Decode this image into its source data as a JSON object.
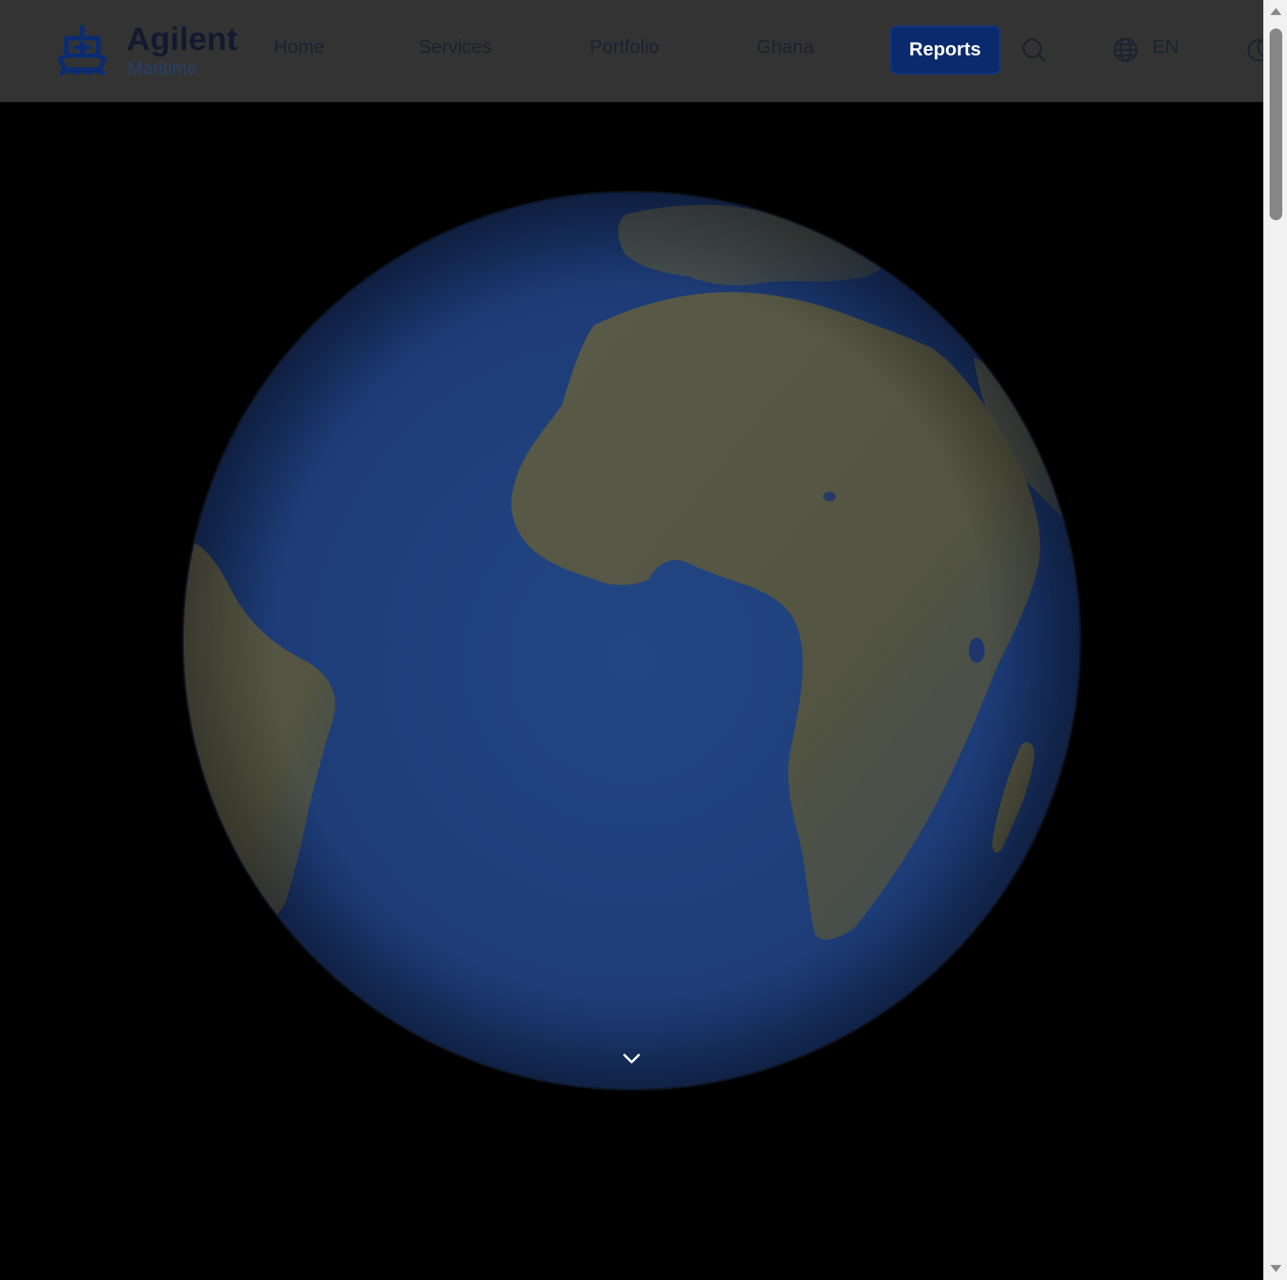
{
  "brand": {
    "title": "Agilent",
    "subtitle": "Maritime",
    "logo_icon": "ship-icon"
  },
  "nav": {
    "links": [
      {
        "label": "Home"
      },
      {
        "label": "Services"
      },
      {
        "label": "Portfolio"
      },
      {
        "label": "Ghana"
      }
    ],
    "cta_label": "Reports",
    "search_icon": "search-icon",
    "language_icon": "globe-icon",
    "language_code": "EN",
    "theme_icon": "moon-icon"
  },
  "hero": {
    "globe_view": "earth-atlantic-africa",
    "scroll_icon": "chevron-down-icon"
  },
  "colors": {
    "navbar_bg": "#333333",
    "cta_bg": "#0b2a6e",
    "ocean": "#1e3c78",
    "land": "#5a5a48",
    "page_bg": "#000000"
  }
}
